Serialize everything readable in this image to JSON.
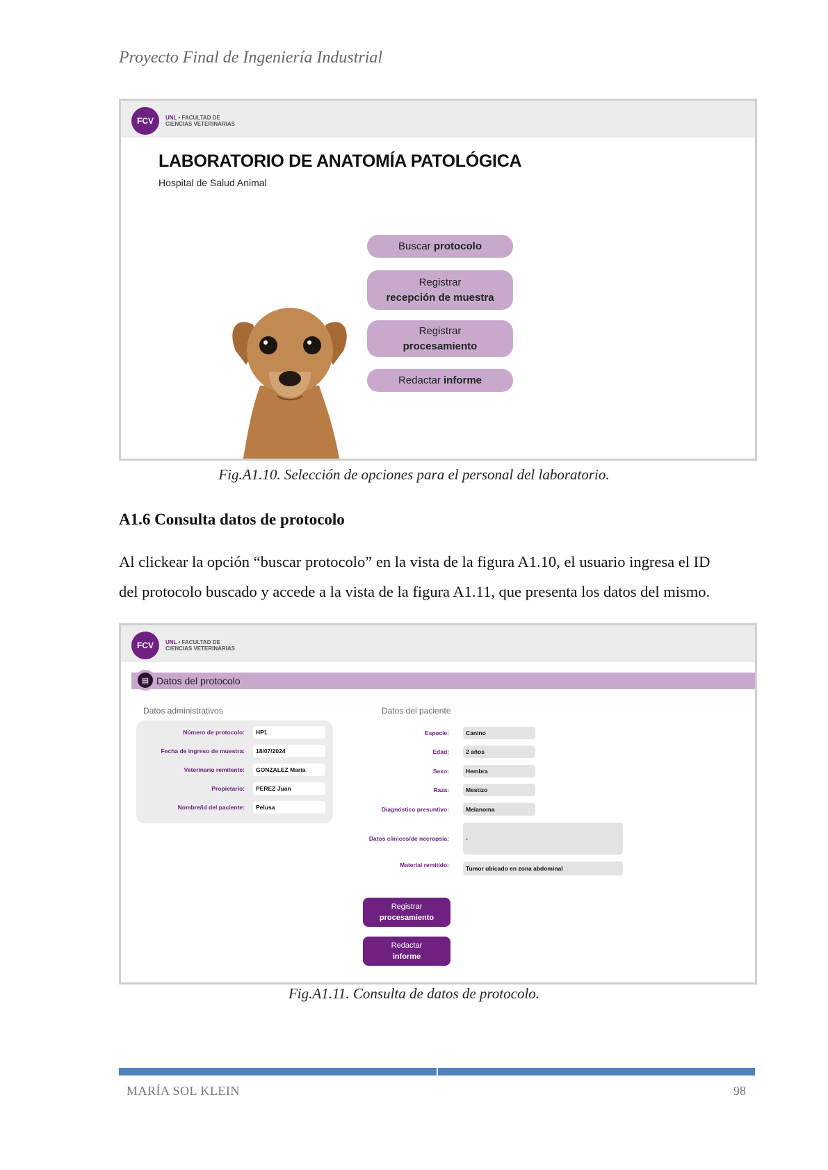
{
  "running_header": "Proyecto Final de Ingeniería Industrial",
  "logo": {
    "badge": "FCV",
    "unl": "UNL",
    "line1": "• FACULTAD DE",
    "line2": "CIENCIAS VETERINARIAS"
  },
  "figure1": {
    "title": "LABORATORIO DE ANATOMÍA PATOLÓGICA",
    "subtitle": "Hospital de Salud Animal",
    "buttons": [
      {
        "normal": "Buscar ",
        "bold": "protocolo"
      },
      {
        "line1": "Registrar",
        "line2": "recepción de muestra"
      },
      {
        "line1": "Registrar",
        "line2": "procesamiento"
      },
      {
        "normal": "Redactar ",
        "bold": "informe"
      }
    ],
    "caption": "Fig.A1.10. Selección de opciones para el personal del laboratorio."
  },
  "section": {
    "heading": "A1.6 Consulta datos de protocolo",
    "paragraph_line1": "Al clickear la opción “buscar protocolo” en la vista de la figura A1.10, el usuario ingresa el ID",
    "paragraph_line2": "del protocolo buscado y accede a la vista de la figura A1.11, que presenta los datos del mismo."
  },
  "figure2": {
    "section_title": "Datos del protocolo",
    "admin_title": "Datos administrativos",
    "patient_title": "Datos del paciente",
    "admin_fields": [
      {
        "label": "Número de protocolo:",
        "value": "HP1"
      },
      {
        "label": "Fecha de ingreso de muestra:",
        "value": "18/07/2024"
      },
      {
        "label": "Veterinario remitente:",
        "value": "GONZALEZ María"
      },
      {
        "label": "Propietario:",
        "value": "PEREZ Juan"
      },
      {
        "label": "Nombre/id del paciente:",
        "value": "Pelusa"
      }
    ],
    "patient_fields": [
      {
        "label": "Especie:",
        "value": "Canino"
      },
      {
        "label": "Edad:",
        "value": "2 años"
      },
      {
        "label": "Sexo:",
        "value": "Hembra"
      },
      {
        "label": "Raza:",
        "value": "Mestizo"
      },
      {
        "label": "Diagnóstico presuntivo:",
        "value": "Melanoma"
      },
      {
        "label": "Datos clínicos/de necropsia:",
        "value": "-"
      },
      {
        "label": "Material remitido:",
        "value": "Tumor ubicado en zona abdominal"
      }
    ],
    "actions": [
      {
        "line1": "Registrar",
        "line2": "procesamiento"
      },
      {
        "line1": "Redactar",
        "line2": "informe"
      }
    ],
    "caption": "Fig.A1.11. Consulta de datos de protocolo."
  },
  "footer": {
    "author": "MARÍA SOL KLEIN",
    "page": "98"
  },
  "colors": {
    "accent": "#6e2180",
    "lilac": "#c8a9cc",
    "footer_rule": "#4f81bd"
  }
}
